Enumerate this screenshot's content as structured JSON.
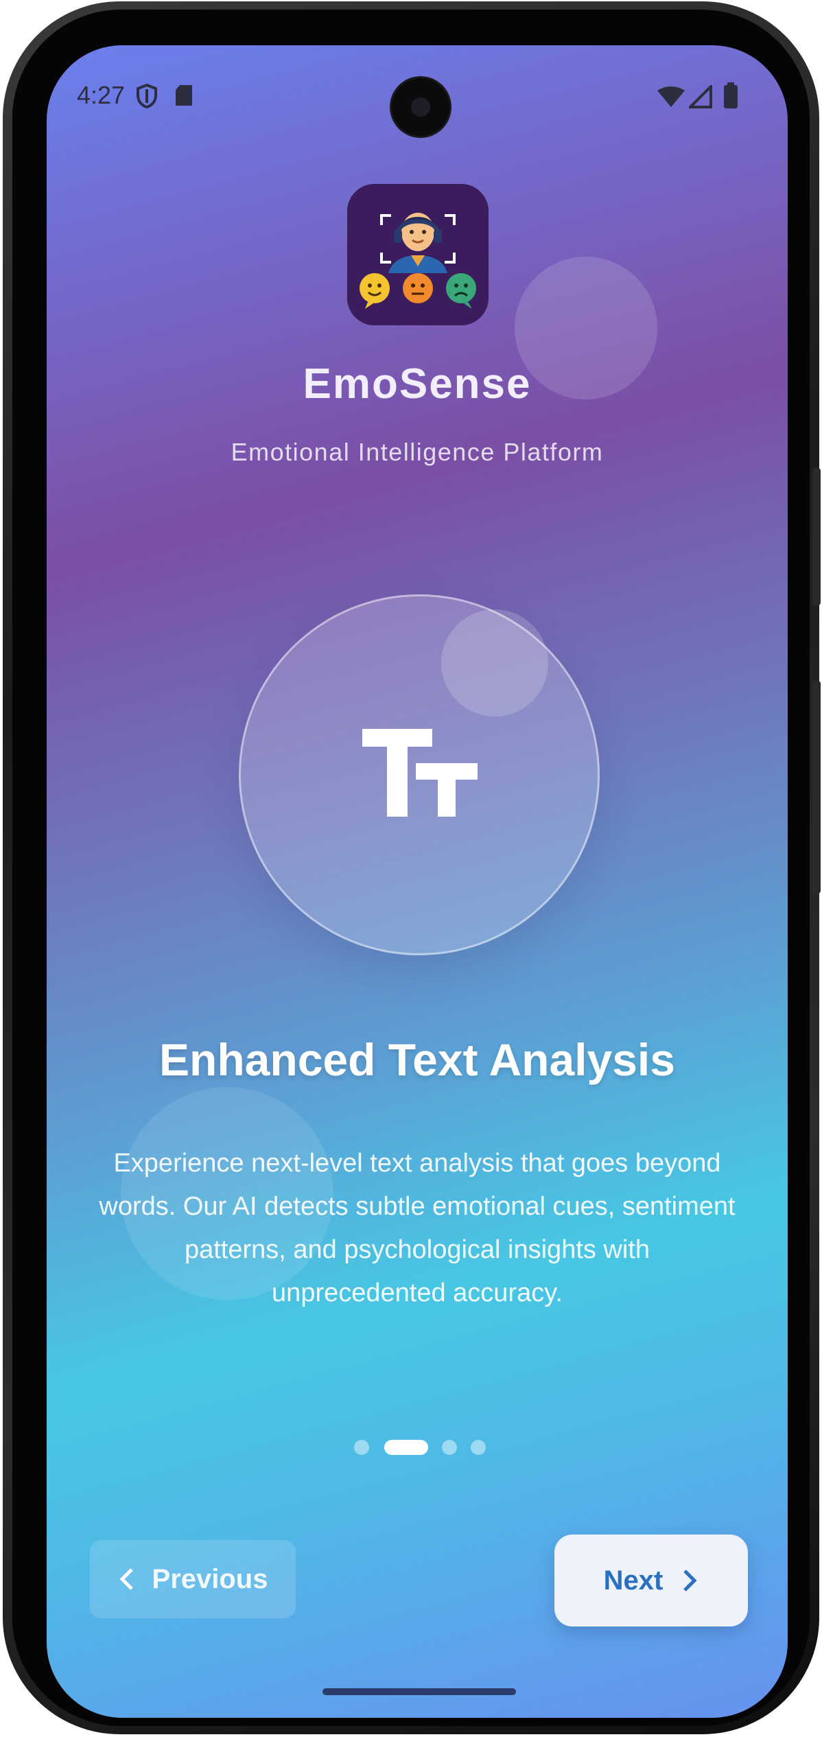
{
  "status_bar": {
    "time": "4:27",
    "left_icons": [
      "shield-icon",
      "sd-card-icon"
    ],
    "right_icons": [
      "wifi-icon",
      "signal-icon",
      "battery-icon"
    ]
  },
  "app": {
    "name": "EmoSense",
    "subtitle": "Emotional Intelligence Platform",
    "icon": "emosense-logo-icon"
  },
  "slide": {
    "icon": "text-fields-icon",
    "icon_glyph": "Tt",
    "title": "Enhanced Text Analysis",
    "description": "Experience next-level text analysis that goes beyond words. Our AI detects subtle emotional cues, sentiment patterns, and psychological insights with unprecedented accuracy."
  },
  "pagination": {
    "total": 4,
    "current_index": 1
  },
  "navigation": {
    "previous_label": "Previous",
    "next_label": "Next"
  },
  "colors": {
    "gradient_top": "#6a80ee",
    "gradient_mid_purple": "#7a4fa6",
    "gradient_cyan": "#48c7e4",
    "next_button_text": "#2a6fc0"
  }
}
